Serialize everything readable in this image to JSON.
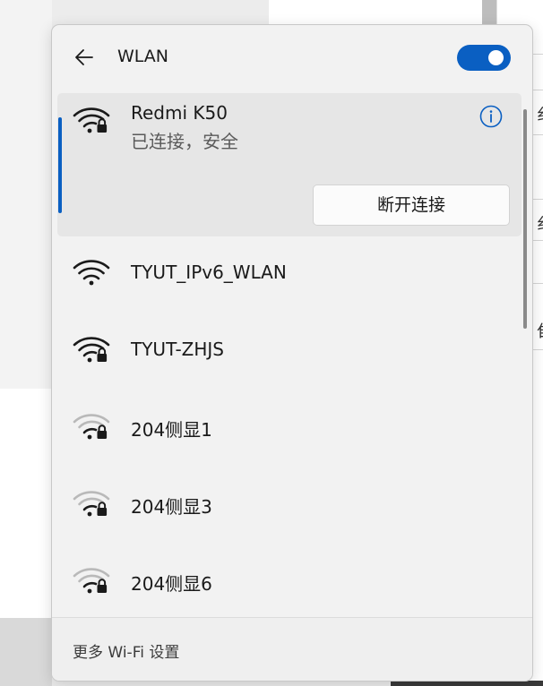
{
  "background": {
    "right_glyphs": [
      "纟",
      "纟",
      "隹"
    ]
  },
  "header": {
    "title": "WLAN",
    "toggle_on": true
  },
  "connected_network": {
    "name": "Redmi K50",
    "status": "已连接，安全",
    "disconnect_label": "断开连接",
    "secured": true,
    "signal": "full"
  },
  "networks": [
    {
      "name": "TYUT_IPv6_WLAN",
      "secured": false,
      "signal": "full"
    },
    {
      "name": "TYUT-ZHJS",
      "secured": true,
      "signal": "full"
    },
    {
      "name": "204侧显1",
      "secured": true,
      "signal": "weak"
    },
    {
      "name": "204侧显3",
      "secured": true,
      "signal": "weak"
    },
    {
      "name": "204侧显6",
      "secured": true,
      "signal": "weak"
    }
  ],
  "footer": {
    "settings_link": "更多 Wi-Fi 设置"
  },
  "colors": {
    "accent": "#0a5fc2",
    "panel": "#f2f2f2",
    "connected_bg": "#e6e6e6"
  }
}
